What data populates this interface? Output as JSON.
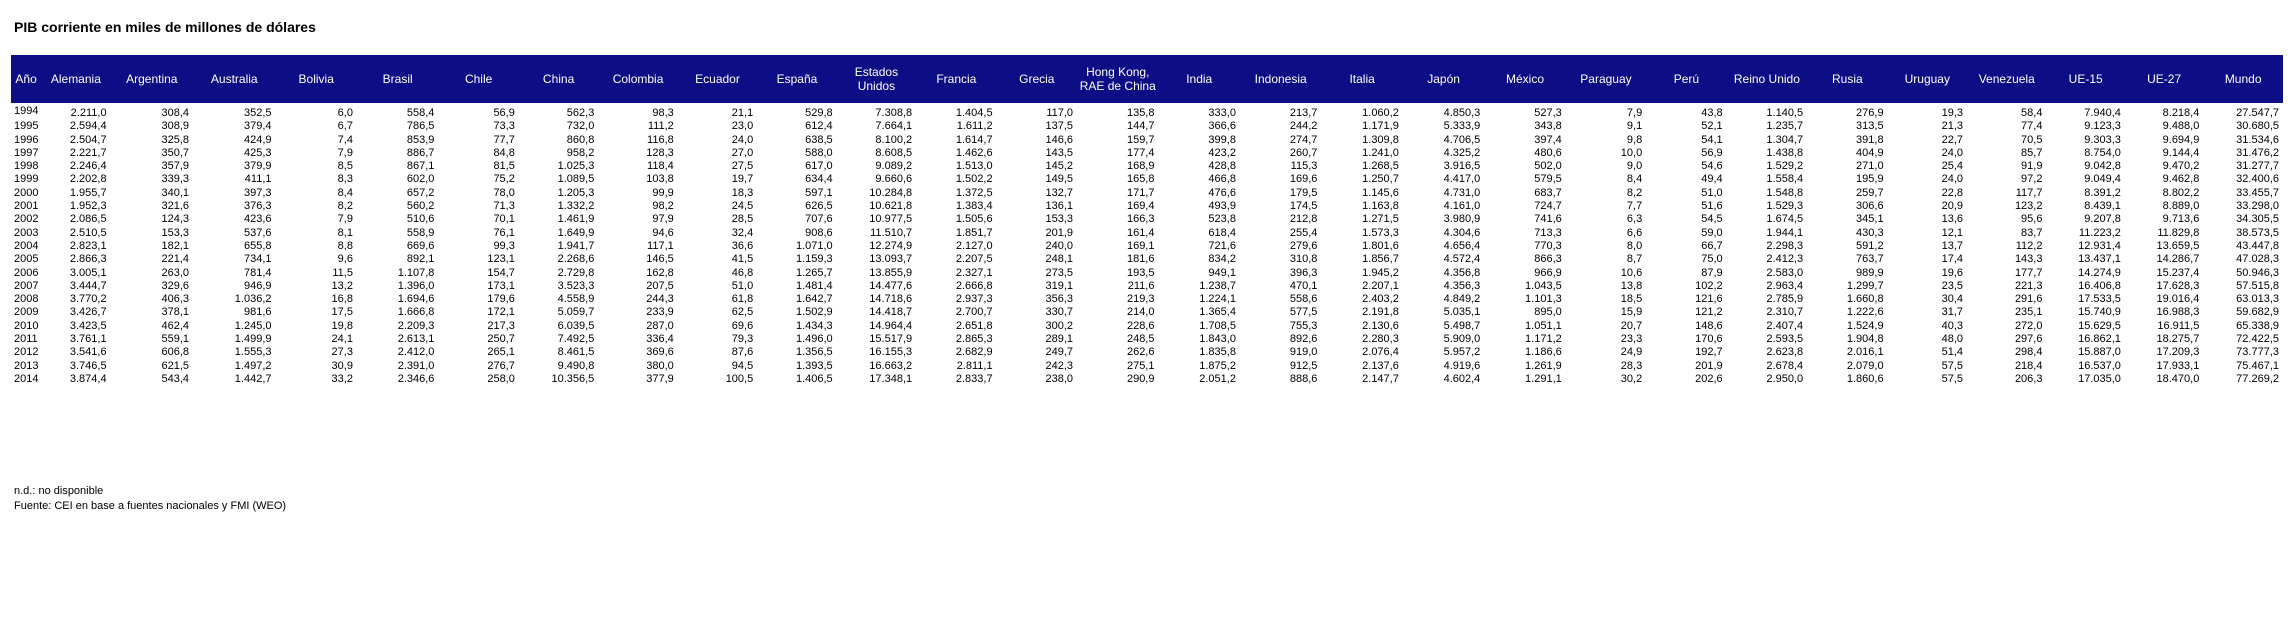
{
  "title": "PIB corriente en miles de millones de dólares",
  "table": {
    "headers": [
      "Año",
      "Alemania",
      "Argentina",
      "Australia",
      "Bolivia",
      "Brasil",
      "Chile",
      "China",
      "Colombia",
      "Ecuador",
      "España",
      "Estados Unidos",
      "Francia",
      "Grecia",
      "Hong Kong, RAE de China",
      "India",
      "Indonesia",
      "Italia",
      "Japón",
      "México",
      "Paraguay",
      "Perú",
      "Reino Unido",
      "Rusia",
      "Uruguay",
      "Venezuela",
      "UE-15",
      "UE-27",
      "Mundo"
    ],
    "rows": [
      [
        "1994",
        "2.211,0",
        "308,4",
        "352,5",
        "6,0",
        "558,4",
        "56,9",
        "562,3",
        "98,3",
        "21,1",
        "529,8",
        "7.308,8",
        "1.404,5",
        "117,0",
        "135,8",
        "333,0",
        "213,7",
        "1.060,2",
        "4.850,3",
        "527,3",
        "7,9",
        "43,8",
        "1.140,5",
        "276,9",
        "19,3",
        "58,4",
        "7.940,4",
        "8.218,4",
        "27.547,7"
      ],
      [
        "1995",
        "2.594,4",
        "308,9",
        "379,4",
        "6,7",
        "786,5",
        "73,3",
        "732,0",
        "111,2",
        "23,0",
        "612,4",
        "7.664,1",
        "1.611,2",
        "137,5",
        "144,7",
        "366,6",
        "244,2",
        "1.171,9",
        "5.333,9",
        "343,8",
        "9,1",
        "52,1",
        "1.235,7",
        "313,5",
        "21,3",
        "77,4",
        "9.123,3",
        "9.488,0",
        "30.680,5"
      ],
      [
        "1996",
        "2.504,7",
        "325,8",
        "424,9",
        "7,4",
        "853,9",
        "77,7",
        "860,8",
        "116,8",
        "24,0",
        "638,5",
        "8.100,2",
        "1.614,7",
        "146,6",
        "159,7",
        "399,8",
        "274,7",
        "1.309,8",
        "4.706,5",
        "397,4",
        "9,8",
        "54,1",
        "1.304,7",
        "391,8",
        "22,7",
        "70,5",
        "9.303,3",
        "9.694,9",
        "31.534,6"
      ],
      [
        "1997",
        "2.221,7",
        "350,7",
        "425,3",
        "7,9",
        "886,7",
        "84,8",
        "958,2",
        "128,3",
        "27,0",
        "588,0",
        "8.608,5",
        "1.462,6",
        "143,5",
        "177,4",
        "423,2",
        "260,7",
        "1.241,0",
        "4.325,2",
        "480,6",
        "10,0",
        "56,9",
        "1.438,8",
        "404,9",
        "24,0",
        "85,7",
        "8.754,0",
        "9.144,4",
        "31.476,2"
      ],
      [
        "1998",
        "2.246,4",
        "357,9",
        "379,9",
        "8,5",
        "867,1",
        "81,5",
        "1.025,3",
        "118,4",
        "27,5",
        "617,0",
        "9.089,2",
        "1.513,0",
        "145,2",
        "168,9",
        "428,8",
        "115,3",
        "1.268,5",
        "3.916,5",
        "502,0",
        "9,0",
        "54,6",
        "1.529,2",
        "271,0",
        "25,4",
        "91,9",
        "9.042,8",
        "9.470,2",
        "31.277,7"
      ],
      [
        "1999",
        "2.202,8",
        "339,3",
        "411,1",
        "8,3",
        "602,0",
        "75,2",
        "1.089,5",
        "103,8",
        "19,7",
        "634,4",
        "9.660,6",
        "1.502,2",
        "149,5",
        "165,8",
        "466,8",
        "169,6",
        "1.250,7",
        "4.417,0",
        "579,5",
        "8,4",
        "49,4",
        "1.558,4",
        "195,9",
        "24,0",
        "97,2",
        "9.049,4",
        "9.462,8",
        "32.400,6"
      ],
      [
        "2000",
        "1.955,7",
        "340,1",
        "397,3",
        "8,4",
        "657,2",
        "78,0",
        "1.205,3",
        "99,9",
        "18,3",
        "597,1",
        "10.284,8",
        "1.372,5",
        "132,7",
        "171,7",
        "476,6",
        "179,5",
        "1.145,6",
        "4.731,0",
        "683,7",
        "8,2",
        "51,0",
        "1.548,8",
        "259,7",
        "22,8",
        "117,7",
        "8.391,2",
        "8.802,2",
        "33.455,7"
      ],
      [
        "2001",
        "1.952,3",
        "321,6",
        "376,3",
        "8,2",
        "560,2",
        "71,3",
        "1.332,2",
        "98,2",
        "24,5",
        "626,5",
        "10.621,8",
        "1.383,4",
        "136,1",
        "169,4",
        "493,9",
        "174,5",
        "1.163,8",
        "4.161,0",
        "724,7",
        "7,7",
        "51,6",
        "1.529,3",
        "306,6",
        "20,9",
        "123,2",
        "8.439,1",
        "8.889,0",
        "33.298,0"
      ],
      [
        "2002",
        "2.086,5",
        "124,3",
        "423,6",
        "7,9",
        "510,6",
        "70,1",
        "1.461,9",
        "97,9",
        "28,5",
        "707,6",
        "10.977,5",
        "1.505,6",
        "153,3",
        "166,3",
        "523,8",
        "212,8",
        "1.271,5",
        "3.980,9",
        "741,6",
        "6,3",
        "54,5",
        "1.674,5",
        "345,1",
        "13,6",
        "95,6",
        "9.207,8",
        "9.713,6",
        "34.305,5"
      ],
      [
        "2003",
        "2.510,5",
        "153,3",
        "537,6",
        "8,1",
        "558,9",
        "76,1",
        "1.649,9",
        "94,6",
        "32,4",
        "908,6",
        "11.510,7",
        "1.851,7",
        "201,9",
        "161,4",
        "618,4",
        "255,4",
        "1.573,3",
        "4.304,6",
        "713,3",
        "6,6",
        "59,0",
        "1.944,1",
        "430,3",
        "12,1",
        "83,7",
        "11.223,2",
        "11.829,8",
        "38.573,5"
      ],
      [
        "2004",
        "2.823,1",
        "182,1",
        "655,8",
        "8,8",
        "669,6",
        "99,3",
        "1.941,7",
        "117,1",
        "36,6",
        "1.071,0",
        "12.274,9",
        "2.127,0",
        "240,0",
        "169,1",
        "721,6",
        "279,6",
        "1.801,6",
        "4.656,4",
        "770,3",
        "8,0",
        "66,7",
        "2.298,3",
        "591,2",
        "13,7",
        "112,2",
        "12.931,4",
        "13.659,5",
        "43.447,8"
      ],
      [
        "2005",
        "2.866,3",
        "221,4",
        "734,1",
        "9,6",
        "892,1",
        "123,1",
        "2.268,6",
        "146,5",
        "41,5",
        "1.159,3",
        "13.093,7",
        "2.207,5",
        "248,1",
        "181,6",
        "834,2",
        "310,8",
        "1.856,7",
        "4.572,4",
        "866,3",
        "8,7",
        "75,0",
        "2.412,3",
        "763,7",
        "17,4",
        "143,3",
        "13.437,1",
        "14.286,7",
        "47.028,3"
      ],
      [
        "2006",
        "3.005,1",
        "263,0",
        "781,4",
        "11,5",
        "1.107,8",
        "154,7",
        "2.729,8",
        "162,8",
        "46,8",
        "1.265,7",
        "13.855,9",
        "2.327,1",
        "273,5",
        "193,5",
        "949,1",
        "396,3",
        "1.945,2",
        "4.356,8",
        "966,9",
        "10,6",
        "87,9",
        "2.583,0",
        "989,9",
        "19,6",
        "177,7",
        "14.274,9",
        "15.237,4",
        "50.946,3"
      ],
      [
        "2007",
        "3.444,7",
        "329,6",
        "946,9",
        "13,2",
        "1.396,0",
        "173,1",
        "3.523,3",
        "207,5",
        "51,0",
        "1.481,4",
        "14.477,6",
        "2.666,8",
        "319,1",
        "211,6",
        "1.238,7",
        "470,1",
        "2.207,1",
        "4.356,3",
        "1.043,5",
        "13,8",
        "102,2",
        "2.963,4",
        "1.299,7",
        "23,5",
        "221,3",
        "16.406,8",
        "17.628,3",
        "57.515,8"
      ],
      [
        "2008",
        "3.770,2",
        "406,3",
        "1.036,2",
        "16,8",
        "1.694,6",
        "179,6",
        "4.558,9",
        "244,3",
        "61,8",
        "1.642,7",
        "14.718,6",
        "2.937,3",
        "356,3",
        "219,3",
        "1.224,1",
        "558,6",
        "2.403,2",
        "4.849,2",
        "1.101,3",
        "18,5",
        "121,6",
        "2.785,9",
        "1.660,8",
        "30,4",
        "291,6",
        "17.533,5",
        "19.016,4",
        "63.013,3"
      ],
      [
        "2009",
        "3.426,7",
        "378,1",
        "981,6",
        "17,5",
        "1.666,8",
        "172,1",
        "5.059,7",
        "233,9",
        "62,5",
        "1.502,9",
        "14.418,7",
        "2.700,7",
        "330,7",
        "214,0",
        "1.365,4",
        "577,5",
        "2.191,8",
        "5.035,1",
        "895,0",
        "15,9",
        "121,2",
        "2.310,7",
        "1.222,6",
        "31,7",
        "235,1",
        "15.740,9",
        "16.988,3",
        "59.682,9"
      ],
      [
        "2010",
        "3.423,5",
        "462,4",
        "1.245,0",
        "19,8",
        "2.209,3",
        "217,3",
        "6.039,5",
        "287,0",
        "69,6",
        "1.434,3",
        "14.964,4",
        "2.651,8",
        "300,2",
        "228,6",
        "1.708,5",
        "755,3",
        "2.130,6",
        "5.498,7",
        "1.051,1",
        "20,7",
        "148,6",
        "2.407,4",
        "1.524,9",
        "40,3",
        "272,0",
        "15.629,5",
        "16.911,5",
        "65.338,9"
      ],
      [
        "2011",
        "3.761,1",
        "559,1",
        "1.499,9",
        "24,1",
        "2.613,1",
        "250,7",
        "7.492,5",
        "336,4",
        "79,3",
        "1.496,0",
        "15.517,9",
        "2.865,3",
        "289,1",
        "248,5",
        "1.843,0",
        "892,6",
        "2.280,3",
        "5.909,0",
        "1.171,2",
        "23,3",
        "170,6",
        "2.593,5",
        "1.904,8",
        "48,0",
        "297,6",
        "16.862,1",
        "18.275,7",
        "72.422,5"
      ],
      [
        "2012",
        "3.541,6",
        "606,8",
        "1.555,3",
        "27,3",
        "2.412,0",
        "265,1",
        "8.461,5",
        "369,6",
        "87,6",
        "1.356,5",
        "16.155,3",
        "2.682,9",
        "249,7",
        "262,6",
        "1.835,8",
        "919,0",
        "2.076,4",
        "5.957,2",
        "1.186,6",
        "24,9",
        "192,7",
        "2.623,8",
        "2.016,1",
        "51,4",
        "298,4",
        "15.887,0",
        "17.209,3",
        "73.777,3"
      ],
      [
        "2013",
        "3.746,5",
        "621,5",
        "1.497,2",
        "30,9",
        "2.391,0",
        "276,7",
        "9.490,8",
        "380,0",
        "94,5",
        "1.393,5",
        "16.663,2",
        "2.811,1",
        "242,3",
        "275,1",
        "1.875,2",
        "912,5",
        "2.137,6",
        "4.919,6",
        "1.261,9",
        "28,3",
        "201,9",
        "2.678,4",
        "2.079,0",
        "57,5",
        "218,4",
        "16.537,0",
        "17.933,1",
        "75.467,1"
      ],
      [
        "2014",
        "3.874,4",
        "543,4",
        "1.442,7",
        "33,2",
        "2.346,6",
        "258,0",
        "10.356,5",
        "377,9",
        "100,5",
        "1.406,5",
        "17.348,1",
        "2.833,7",
        "238,0",
        "290,9",
        "2.051,2",
        "888,6",
        "2.147,7",
        "4.602,4",
        "1.291,1",
        "30,2",
        "202,6",
        "2.950,0",
        "1.860,6",
        "57,5",
        "206,3",
        "17.035,0",
        "18.470,0",
        "77.269,2"
      ]
    ]
  },
  "footer": {
    "note": "n.d.: no disponible",
    "source": "Fuente: CEI en base a fuentes nacionales y FMI (WEO)"
  }
}
